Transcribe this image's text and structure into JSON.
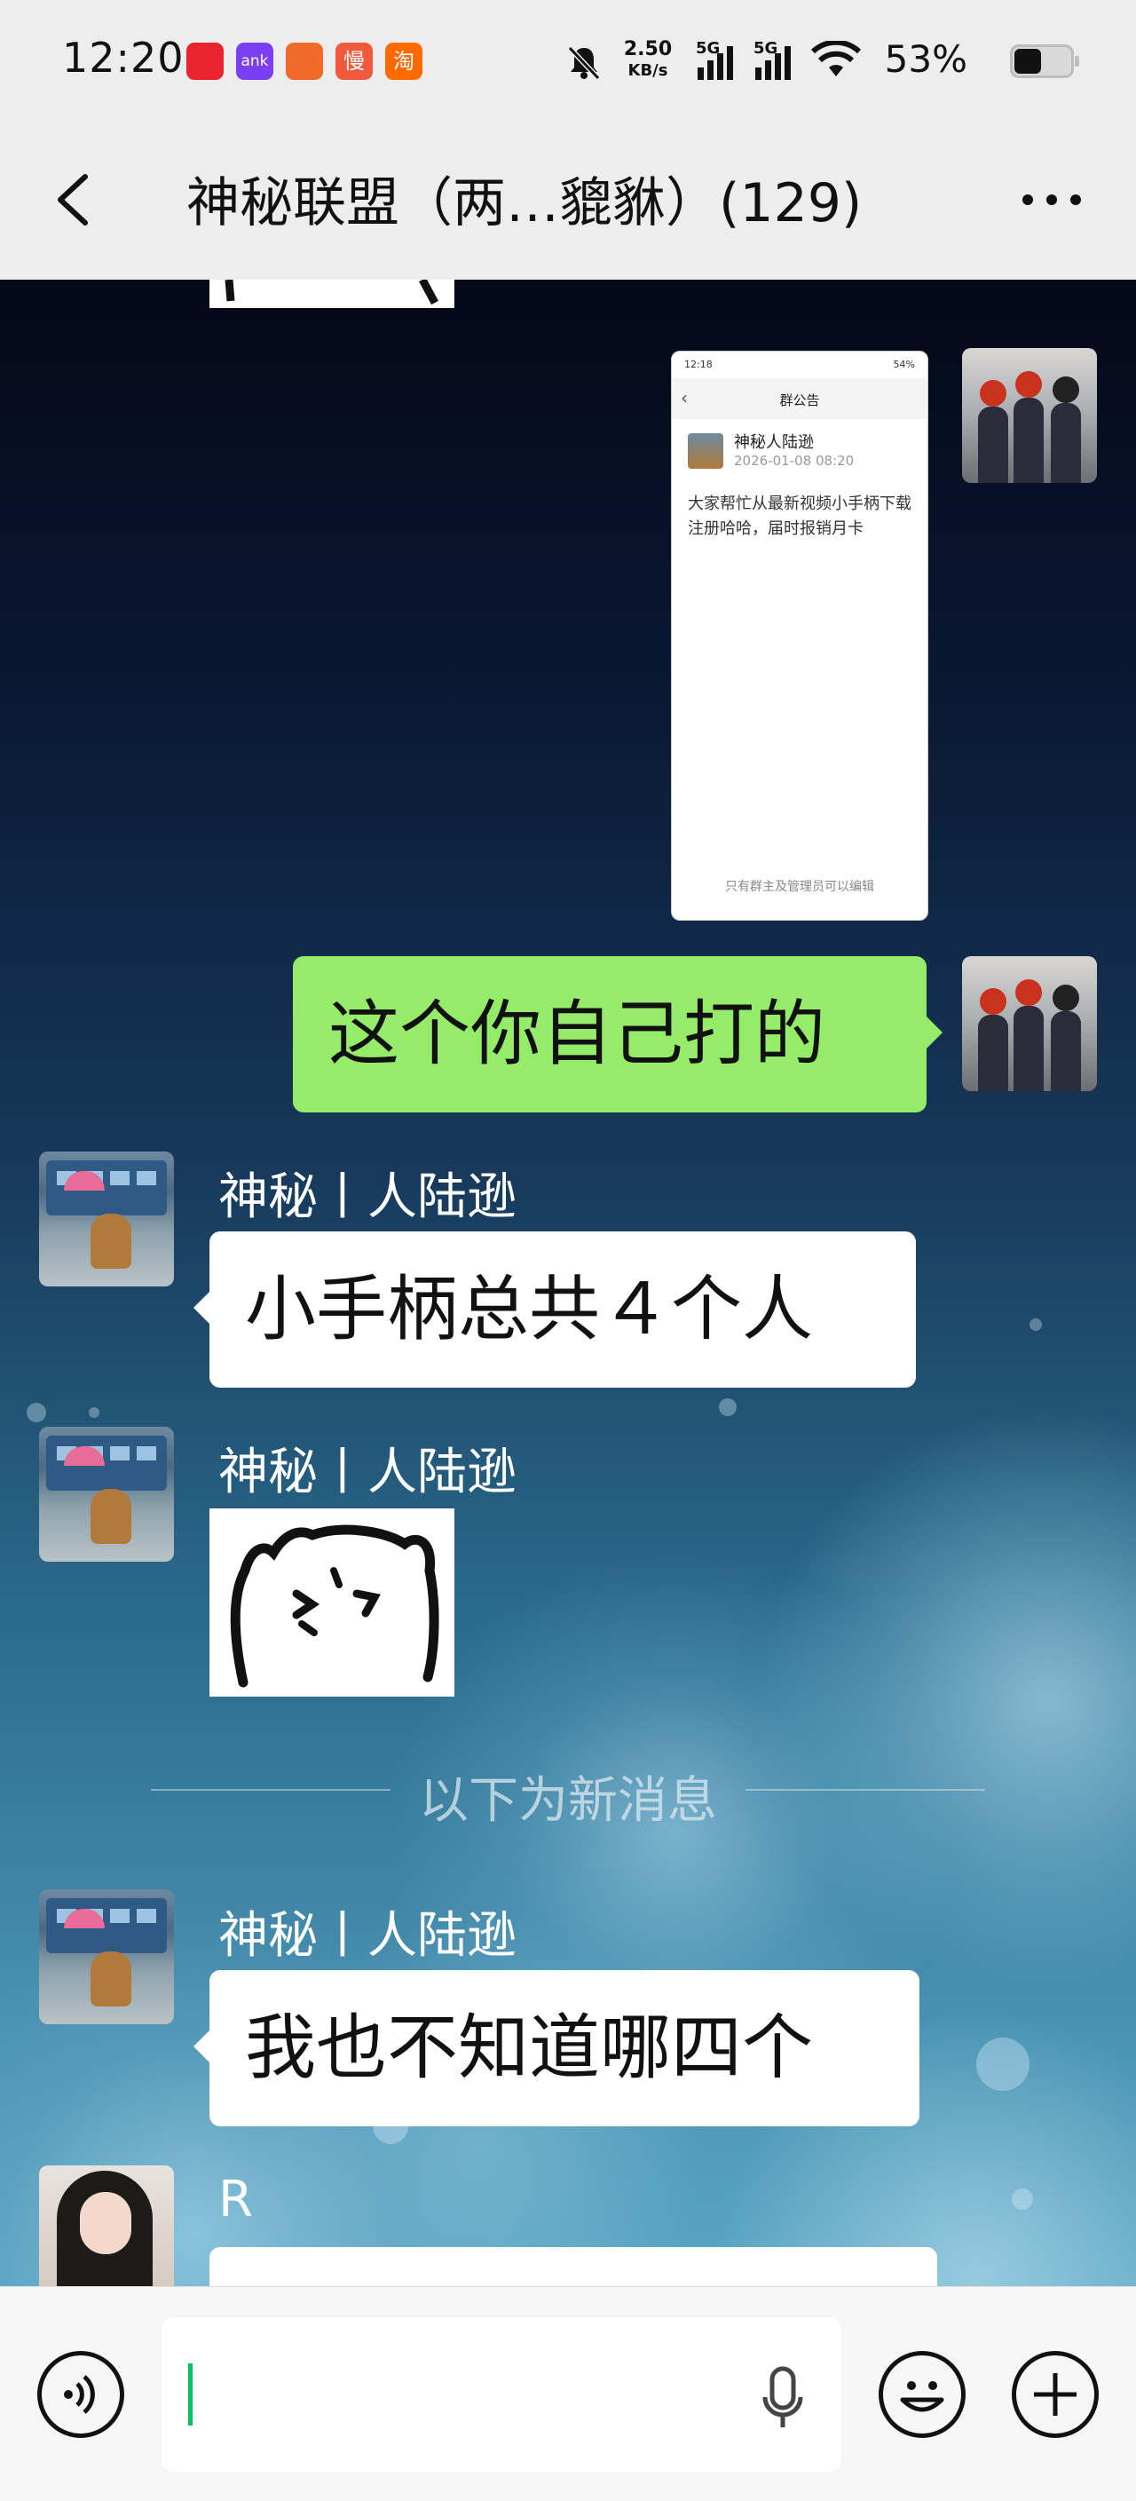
{
  "status_bar": {
    "time": "12:20",
    "app_icons": [
      {
        "name": "red-app-icon",
        "label": "",
        "color": "#e8242f"
      },
      {
        "name": "bank-app-icon",
        "label": "ank",
        "color": "#7b3ff2"
      },
      {
        "name": "orange-app-icon",
        "label": "",
        "color": "#f06b2a"
      },
      {
        "name": "slow-app-icon",
        "label": "慢",
        "color": "#f05a3c"
      },
      {
        "name": "taobao-app-icon",
        "label": "淘",
        "color": "#ff6a00"
      }
    ],
    "net_speed_value": "2.50",
    "net_speed_unit": "KB/s",
    "signal_1_label": "5G",
    "signal_2_label": "5G",
    "battery_percent": "53%"
  },
  "title_bar": {
    "title": "神秘联盟（两…貔貅）(129)"
  },
  "messages": {
    "screenshot": {
      "status_time": "12:18",
      "status_right": "54%",
      "header_title": "群公告",
      "author": "神秘人陆逊",
      "date": "2026-01-08 08:20",
      "body": "大家帮忙从最新视频小手柄下载注册哈哈，届时报销月卡",
      "footer": "只有群主及管理员可以编辑"
    },
    "msg_green": "这个你自己打的",
    "sender_1": "神秘丨人陆逊",
    "msg_1": "小手柄总共４个人",
    "sender_2": "神秘丨人陆逊",
    "divider": "以下为新消息",
    "sender_3": "神秘丨人陆逊",
    "msg_3": "我也不知道哪四个",
    "sender_4": "R"
  },
  "colors": {
    "green_bubble": "#95ec69",
    "cursor": "#07c160"
  }
}
